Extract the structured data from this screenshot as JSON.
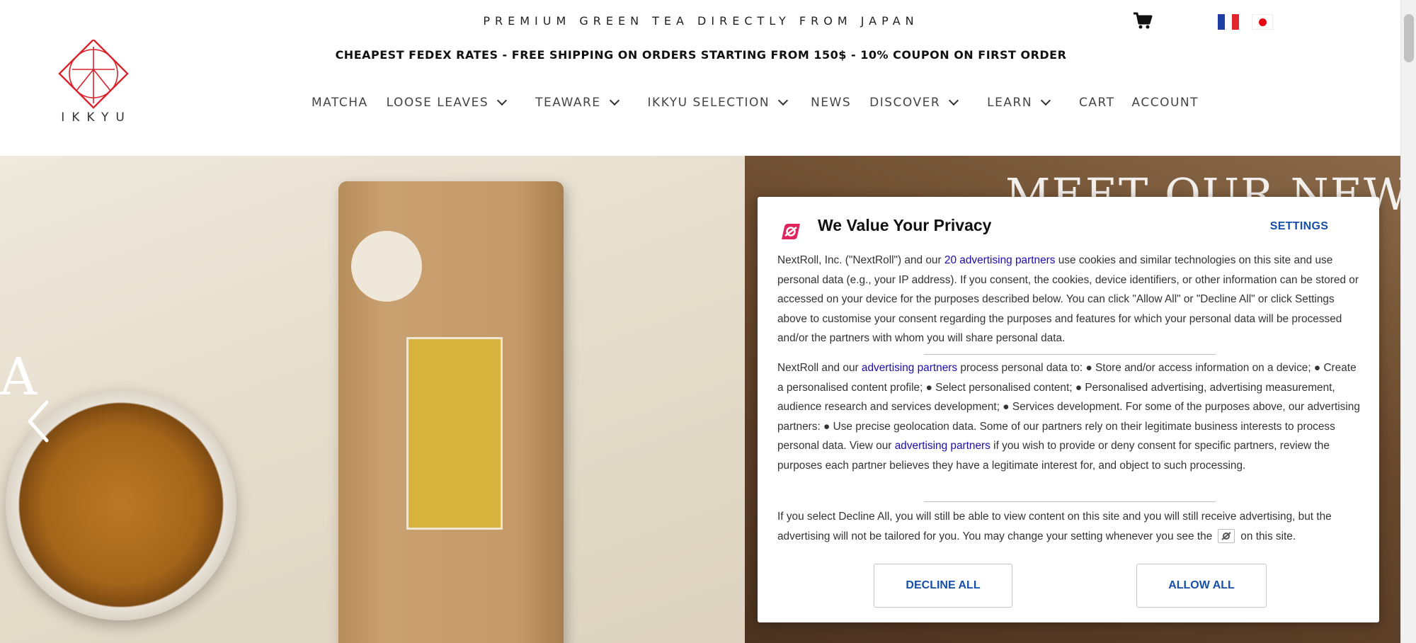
{
  "header": {
    "tagline": "PREMIUM GREEN TEA DIRECTLY FROM JAPAN",
    "shipping_banner": "CHEAPEST FEDEX RATES - FREE SHIPPING ON ORDERS STARTING FROM 150$ - 10% COUPON ON FIRST ORDER",
    "cart_icon": "shopping-cart-icon",
    "languages": [
      "fr",
      "jp"
    ],
    "logo_text": "IKKYU"
  },
  "nav": {
    "items": [
      {
        "label": "MATCHA",
        "dropdown": false
      },
      {
        "label": "LOOSE LEAVES",
        "dropdown": true
      },
      {
        "label": "TEAWARE",
        "dropdown": true
      },
      {
        "label": "IKKYU SELECTION",
        "dropdown": true
      },
      {
        "label": "NEWS",
        "dropdown": false
      },
      {
        "label": "DISCOVER",
        "dropdown": true
      },
      {
        "label": "LEARN",
        "dropdown": true
      },
      {
        "label": "CART",
        "dropdown": false
      },
      {
        "label": "ACCOUNT",
        "dropdown": false
      }
    ]
  },
  "hero": {
    "title": "MEET OUR NEW",
    "side_letter": "A",
    "prev_icon": "chevron-left-icon"
  },
  "privacy": {
    "title": "We Value Your Privacy",
    "settings_label": "SETTINGS",
    "p1_before": "NextRoll, Inc. (\"NextRoll\") and our ",
    "p1_link": "20 advertising partners",
    "p1_after": " use cookies and similar technologies on this site and use personal data (e.g., your IP address). If you consent, the cookies, device identifiers, or other information can be stored or accessed on your device for the purposes described below. You can click \"Allow All\" or \"Decline All\" or click Settings above to customise your consent regarding the purposes and features for which your personal data will be processed and/or the partners with whom you will share personal data.",
    "p2_before": "NextRoll and our ",
    "p2_link1": "advertising partners",
    "p2_middle": " process personal data to: ● Store and/or access information on a device; ● Create a personalised content profile; ● Select personalised content; ● Personalised advertising, advertising measurement, audience research and services development; ● Services development. For some of the purposes above, our advertising partners: ● Use precise geolocation data. Some of our partners rely on their legitimate business interests to process personal data. View our ",
    "p2_link2": "advertising partners",
    "p2_after": " if you wish to provide or deny consent for specific partners, review the purposes each partner believes they have a legitimate interest for, and object to such processing.",
    "p3_before": "If you select Decline All, you will still be able to view content on this site and you will still receive advertising, but the advertising will not be tailored for you. You may change your setting whenever you see the",
    "p3_after": "on this site.",
    "decline_label": "DECLINE ALL",
    "allow_label": "ALLOW ALL",
    "accent_color": "#174ea6",
    "link_color": "#1a0dab",
    "brand_color": "#e0245e"
  }
}
